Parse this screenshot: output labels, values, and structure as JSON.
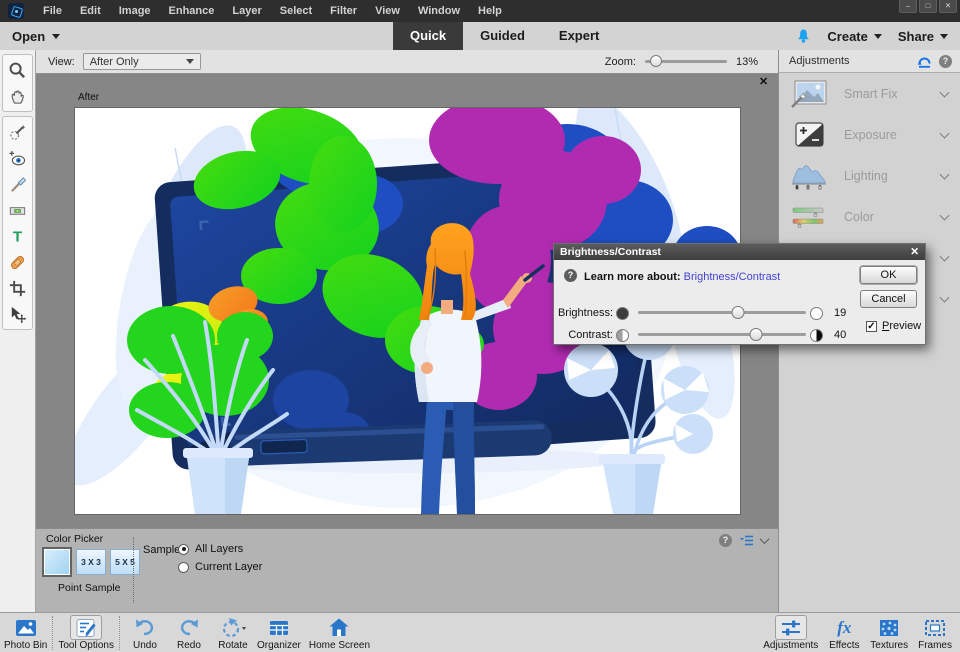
{
  "menubar": {
    "items": [
      "File",
      "Edit",
      "Image",
      "Enhance",
      "Layer",
      "Select",
      "Filter",
      "View",
      "Window",
      "Help"
    ]
  },
  "window_controls": {
    "minimize": "–",
    "maximize": "□",
    "close": "✕"
  },
  "tabbar": {
    "open_label": "Open",
    "tabs": [
      {
        "label": "Quick",
        "active": true
      },
      {
        "label": "Guided",
        "active": false
      },
      {
        "label": "Expert",
        "active": false
      }
    ],
    "create_label": "Create",
    "share_label": "Share"
  },
  "viewbar": {
    "view_label": "View:",
    "view_value": "After Only",
    "zoom_label": "Zoom:",
    "zoom_value": "13%",
    "zoom_percent": 13
  },
  "canvas": {
    "after_label": "After"
  },
  "toolbar": {
    "tools": [
      "zoom-tool",
      "hand-tool",
      "quick-selection-tool",
      "red-eye-removal-tool",
      "whiten-teeth-tool",
      "straighten-tool",
      "type-tool",
      "spot-healing-brush-tool",
      "crop-tool",
      "move-tool"
    ]
  },
  "adjustments_panel": {
    "title": "Adjustments",
    "rows": [
      {
        "label": "Smart Fix",
        "icon": "smart-fix"
      },
      {
        "label": "Exposure",
        "icon": "exposure"
      },
      {
        "label": "Lighting",
        "icon": "lighting"
      },
      {
        "label": "Color",
        "icon": "color"
      },
      {
        "label": "",
        "icon": ""
      },
      {
        "label": "",
        "icon": ""
      }
    ]
  },
  "dialog": {
    "title": "Brightness/Contrast",
    "learn_more_label": "Learn more about:",
    "learn_more_link": "Brightness/Contrast",
    "ok_label": "OK",
    "cancel_label": "Cancel",
    "preview_label_p": "P",
    "preview_label_rest": "review",
    "sliders": [
      {
        "label": "Brightness:",
        "value": 19,
        "min": -100,
        "max": 100
      },
      {
        "label": "Contrast:",
        "value": 40,
        "min": -100,
        "max": 100
      }
    ]
  },
  "tool_options_panel": {
    "title": "Color Picker",
    "grid3_label": "3 X 3",
    "grid5_label": "5 X 5",
    "point_sample_label": "Point Sample",
    "sample_label": "Sample:",
    "radio_options": [
      {
        "label": "All Layers",
        "selected": true
      },
      {
        "label": "Current Layer",
        "selected": false
      }
    ]
  },
  "taskbar": {
    "left_items": [
      {
        "label": "Photo Bin",
        "icon": "photo-bin"
      },
      {
        "label": "Tool Options",
        "icon": "tool-options",
        "active": true
      },
      {
        "label": "Undo",
        "icon": "undo-arrow"
      },
      {
        "label": "Redo",
        "icon": "redo-arrow"
      },
      {
        "label": "Rotate",
        "icon": "rotate-arrow"
      },
      {
        "label": "Organizer",
        "icon": "organizer-grid"
      },
      {
        "label": "Home Screen",
        "icon": "home"
      }
    ],
    "right_items": [
      {
        "label": "Adjustments",
        "icon": "adjust-sliders",
        "active": true
      },
      {
        "label": "Effects",
        "icon": "fx",
        "glyph": "fx"
      },
      {
        "label": "Textures",
        "icon": "texture"
      },
      {
        "label": "Frames",
        "icon": "frame"
      }
    ]
  },
  "icons": {
    "close": "✕",
    "help": "?",
    "check": "✓"
  },
  "colors": {
    "accent_bell_blue": "#1ba3f2",
    "taskbar_icon_blue": "#2a77c9",
    "link_purple": "#4343d6",
    "active_tab_bg": "#3a3a3a",
    "panel_label_gray": "#9b9b9b",
    "reset_icon_blue": "#1473e6"
  }
}
